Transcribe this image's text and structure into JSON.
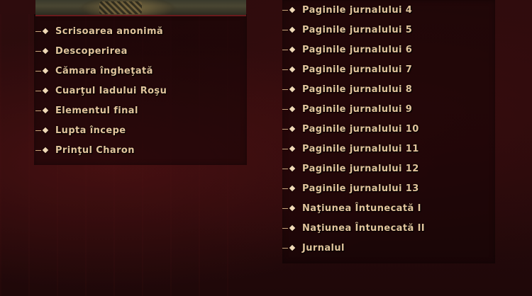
{
  "left_list": [
    {
      "label": "Scrisoarea anonimă"
    },
    {
      "label": "Descoperirea"
    },
    {
      "label": "Cămara îngheţată"
    },
    {
      "label": "Cuarţul Iadului Roşu"
    },
    {
      "label": "Elementul final"
    },
    {
      "label": "Lupta începe"
    },
    {
      "label": "Prinţul Charon"
    }
  ],
  "right_list": [
    {
      "label": "Paginile jurnalului 4"
    },
    {
      "label": "Paginile jurnalului 5"
    },
    {
      "label": "Paginile jurnalului 6"
    },
    {
      "label": "Paginile jurnalului 7"
    },
    {
      "label": "Paginile jurnalului 8"
    },
    {
      "label": "Paginile jurnalului 9"
    },
    {
      "label": "Paginile jurnalului 10"
    },
    {
      "label": "Paginile jurnalului 11"
    },
    {
      "label": "Paginile jurnalului 12"
    },
    {
      "label": "Paginile jurnalului 13"
    },
    {
      "label": "Naţiunea Întunecată I"
    },
    {
      "label": "Naţiunea Întunecată II"
    },
    {
      "label": "Jurnalul"
    }
  ],
  "icons": {
    "bullet": "diamond-bullet-icon"
  },
  "colors": {
    "background": "#2a0b0c",
    "link_text": "#e2c49c",
    "bullet": "#f0d9b6"
  }
}
